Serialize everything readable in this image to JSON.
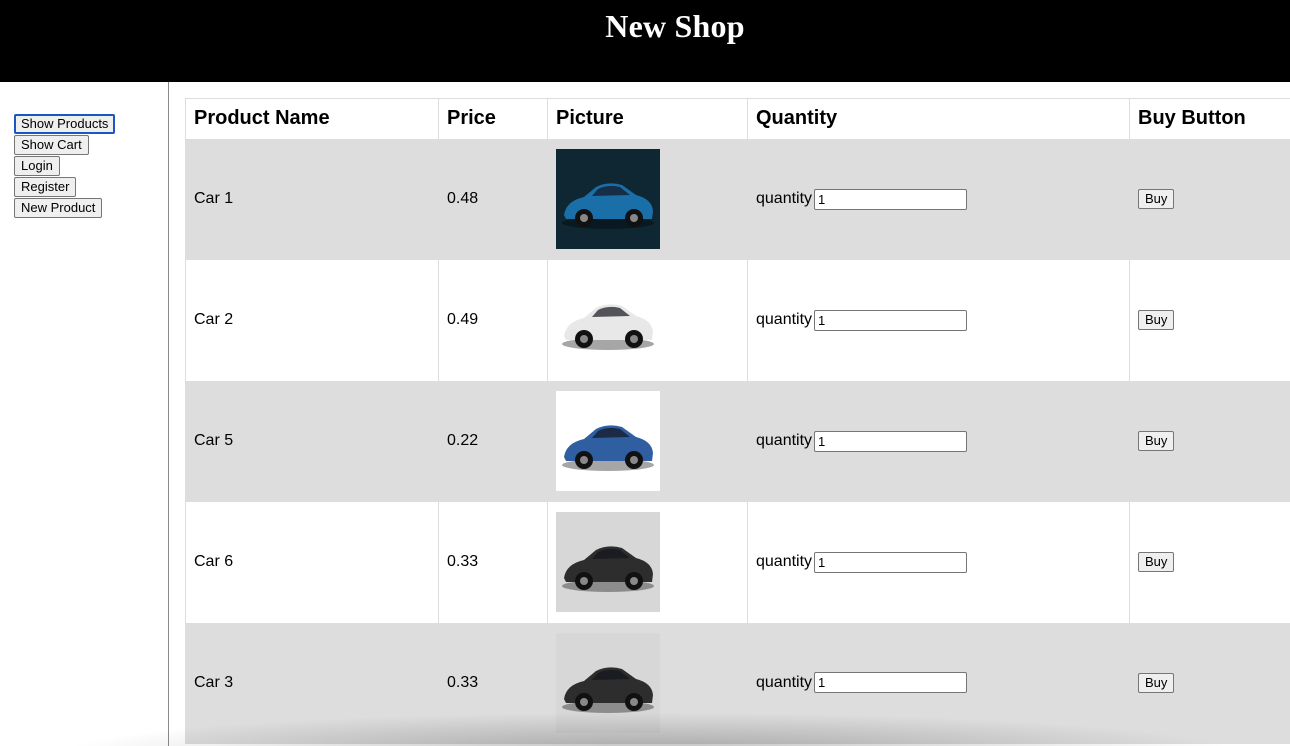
{
  "header": {
    "title": "New Shop"
  },
  "sidebar": {
    "buttons": [
      {
        "label": "Show Products",
        "active": true
      },
      {
        "label": "Show Cart"
      },
      {
        "label": "Login"
      },
      {
        "label": "Register"
      },
      {
        "label": "New Product"
      }
    ]
  },
  "table": {
    "columns": [
      "Product Name",
      "Price",
      "Picture",
      "Quantity",
      "Buy Button"
    ],
    "quantity_label": "quantity",
    "buy_label": "Buy",
    "rows": [
      {
        "name": "Car 1",
        "price": "0.48",
        "quantity": "1",
        "car_color": "#1b6fa8",
        "bg": "#0f2733"
      },
      {
        "name": "Car 2",
        "price": "0.49",
        "quantity": "1",
        "car_color": "#e8e8e8",
        "bg": "#ffffff"
      },
      {
        "name": "Car 5",
        "price": "0.22",
        "quantity": "1",
        "car_color": "#2f5fa0",
        "bg": "#ffffff"
      },
      {
        "name": "Car 6",
        "price": "0.33",
        "quantity": "1",
        "car_color": "#2d2d2d",
        "bg": "#d7d7d7"
      },
      {
        "name": "Car 3",
        "price": "0.33",
        "quantity": "1",
        "car_color": "#2d2d2d",
        "bg": "#d7d7d7"
      }
    ]
  }
}
